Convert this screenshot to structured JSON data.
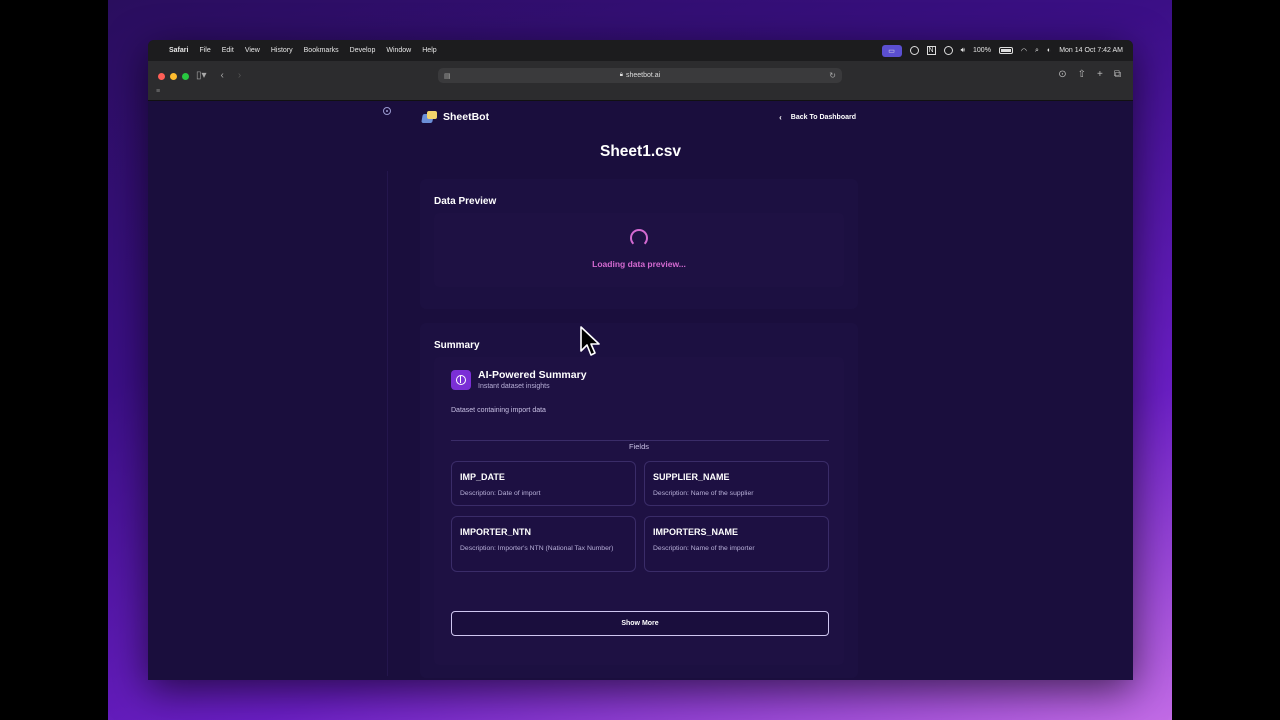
{
  "menubar": {
    "apple": "",
    "app": "Safari",
    "items": [
      "File",
      "Edit",
      "View",
      "History",
      "Bookmarks",
      "Develop",
      "Window",
      "Help"
    ],
    "battery": "100%",
    "datetime": "Mon 14 Oct  7:42 AM"
  },
  "browser": {
    "url": "sheetbot.ai"
  },
  "app": {
    "brand": "SheetBot",
    "back_label": "Back To Dashboard",
    "file_title": "Sheet1.csv"
  },
  "preview": {
    "title": "Data Preview",
    "loading_text": "Loading data preview..."
  },
  "summary": {
    "title": "Summary",
    "ai_title": "AI-Powered Summary",
    "ai_subtitle": "Instant dataset insights",
    "description": "Dataset containing import data",
    "fields_label": "Fields",
    "fields": [
      {
        "name": "IMP_DATE",
        "description": "Description: Date of import"
      },
      {
        "name": "SUPPLIER_NAME",
        "description": "Description: Name of the supplier"
      },
      {
        "name": "IMPORTER_NTN",
        "description": "Description: Importer's NTN (National Tax Number)"
      },
      {
        "name": "IMPORTERS_NAME",
        "description": "Description: Name of the importer"
      }
    ],
    "show_more": "Show More"
  },
  "colors": {
    "page_bg": "#1a0e3d",
    "accent_pink": "#d46ad1",
    "ai_icon": "#7b2fd6"
  }
}
